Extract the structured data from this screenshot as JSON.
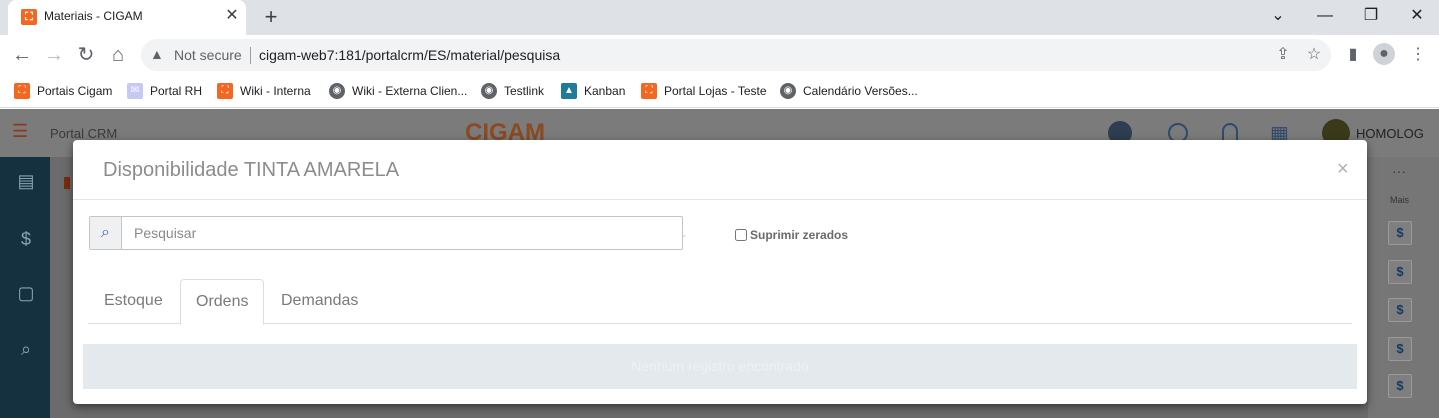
{
  "browser": {
    "tab_title": "Materiais - CIGAM",
    "tab_close": "✕",
    "new_tab": "+",
    "window_controls": {
      "dropdown": "⌄",
      "minimize": "—",
      "restore": "❐",
      "close": "✕"
    },
    "security_label": "Not secure",
    "url": "cigam-web7:181/portalcrm/ES/material/pesquisa",
    "bookmarks": [
      {
        "label": "Portais Cigam",
        "icon": "cigam-icon"
      },
      {
        "label": "Portal RH",
        "icon": "chat-icon"
      },
      {
        "label": "Wiki - Interna",
        "icon": "cigam-icon"
      },
      {
        "label": "Wiki - Externa Clien...",
        "icon": "globe-icon"
      },
      {
        "label": "Testlink",
        "icon": "globe-icon"
      },
      {
        "label": "Kanban",
        "icon": "kanban-icon"
      },
      {
        "label": "Portal Lojas - Teste",
        "icon": "cigam-icon"
      },
      {
        "label": "Calendário Versões...",
        "icon": "globe-icon"
      }
    ]
  },
  "app": {
    "header_title": "Portal CRM",
    "logo_text": "CIGAM",
    "user_label": "HOMOLOG",
    "more_label": "Mais",
    "dollar_symbol": "$"
  },
  "modal": {
    "title": "Disponibilidade TINTA AMARELA",
    "close_symbol": "×",
    "search_placeholder": "Pesquisar",
    "suprimir_label": "Suprimir zerados",
    "tabs": [
      {
        "label": "Estoque",
        "active": false
      },
      {
        "label": "Ordens",
        "active": true
      },
      {
        "label": "Demandas",
        "active": false
      }
    ],
    "notice": "Nenhum registro encontrado"
  }
}
